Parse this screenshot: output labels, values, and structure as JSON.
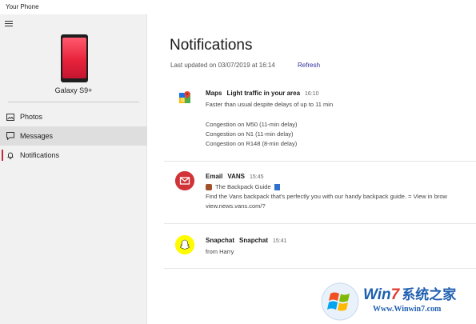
{
  "app": {
    "title": "Your Phone"
  },
  "sidebar": {
    "device_name": "Galaxy S9+",
    "items": [
      {
        "label": "Photos",
        "icon": "image-icon"
      },
      {
        "label": "Messages",
        "icon": "message-icon"
      },
      {
        "label": "Notifications",
        "icon": "bell-icon"
      }
    ]
  },
  "main": {
    "title": "Notifications",
    "last_updated": "Last updated on 03/07/2019 at 16:14",
    "refresh_label": "Refresh",
    "notifications": [
      {
        "app": "Maps",
        "headline": "Light traffic in your area",
        "time": "16:10",
        "lines": [
          "Faster than usual despite delays of up to 11 min",
          "Congestion on M50 (11-min delay)",
          "Congestion on N1 (11-min delay)",
          "Congestion on R148 (8-min delay)"
        ]
      },
      {
        "app": "Email",
        "headline": "VANS",
        "time": "15:45",
        "lines": [
          "The Backpack Guide",
          "Find the Vans backpack that's perfectly you with our handy backpack guide. = View in brow",
          "view.news.vans.com/?"
        ]
      },
      {
        "app": "Snapchat",
        "headline": "Snapchat",
        "time": "15:41",
        "lines": [
          "from Harry"
        ]
      }
    ]
  },
  "watermark": {
    "brand_prefix": "Win",
    "brand_digit": "7",
    "brand_cn": "系统之家",
    "url": "Www.Winwin7.com"
  },
  "colors": {
    "accent": "#c1283a",
    "link": "#2c2c9a",
    "sidebar_bg": "#f1f1f1"
  }
}
